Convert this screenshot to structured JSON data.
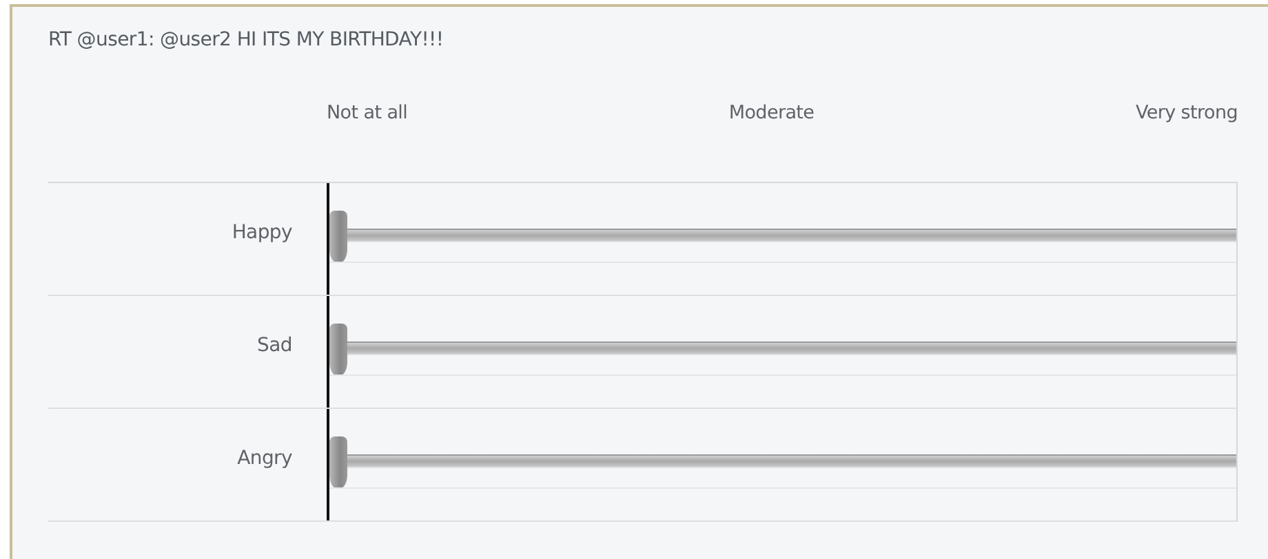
{
  "question": "RT @user1: @user2 HI ITS MY BIRTHDAY!!!",
  "scale_labels": [
    "Not at all",
    "Moderate",
    "Very strong"
  ],
  "sliders": [
    {
      "label": "Happy",
      "level": 0
    },
    {
      "label": "Sad",
      "level": 0
    },
    {
      "label": "Angry",
      "level": 0
    }
  ]
}
